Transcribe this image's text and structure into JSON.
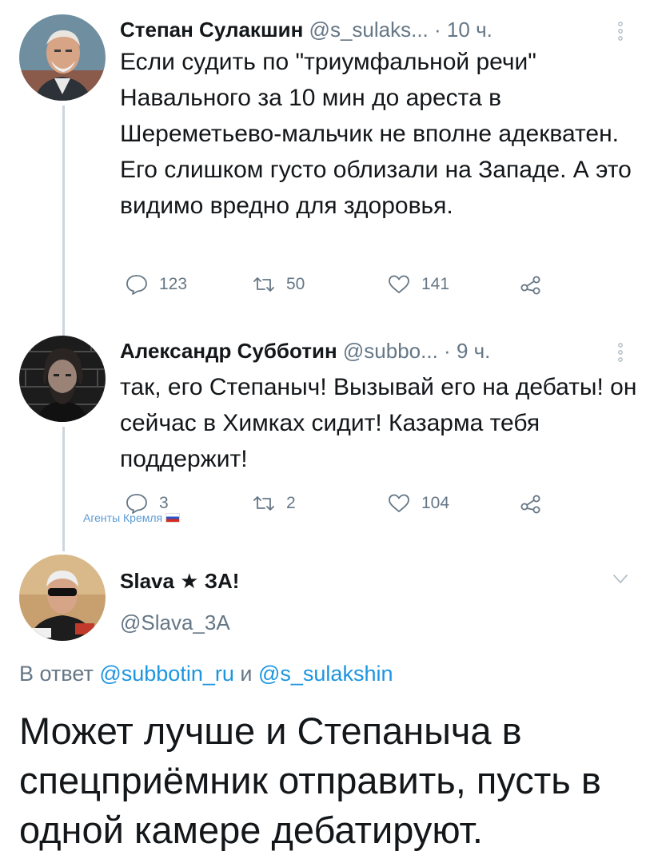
{
  "tweets": [
    {
      "name": "Степан Сулакшин",
      "handle": "@s_sulaks...",
      "separator": "·",
      "time": "10 ч.",
      "text": "Если судить по \"триумфальной речи\" Навального за 10 мин до ареста в Шереметьево-мальчик не вполне адекватен. Его слишком густо облизали на Западе. А это видимо вредно для здоровья.",
      "replies": "123",
      "retweets": "50",
      "likes": "141"
    },
    {
      "name": "Александр Субботин",
      "handle": "@subbo...",
      "separator": "·",
      "time": "9 ч.",
      "text": "так, его Степаныч! Вызывай его на дебаты! он сейчас в Химках сидит! Казарма тебя поддержит!",
      "replies": "3",
      "retweets": "2",
      "likes": "104"
    }
  ],
  "watermark": "Агенты Кремля",
  "main_tweet": {
    "name": "Slava ★ ЗА!",
    "handle": "@Slava_3A",
    "reply_prefix": "В ответ",
    "reply_to_1": "@subbotin_ru",
    "reply_and": "и",
    "reply_to_2": "@s_sulakshin",
    "text": "Может лучше и Степаныча в спецприёмник отправить, пусть в одной камере дебатируют."
  },
  "icons": {
    "reply": "reply-bubble-icon",
    "retweet": "retweet-icon",
    "like": "heart-icon",
    "share": "share-icon",
    "more": "more-vertical-icon",
    "caret": "chevron-down-icon",
    "flag": "russian-flag-icon"
  },
  "colors": {
    "text": "#14171a",
    "secondary": "#657786",
    "link": "#1b95e0",
    "thread_line": "#ccd6dd"
  }
}
